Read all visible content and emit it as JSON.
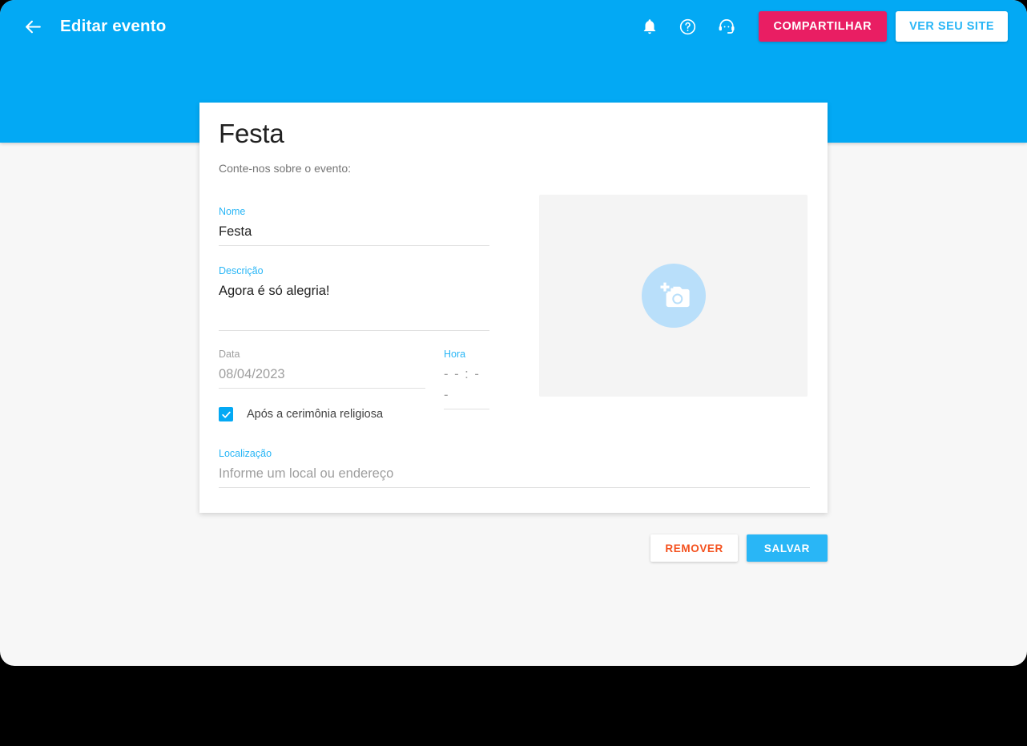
{
  "topbar": {
    "back_icon": "arrow-left-icon",
    "title": "Editar evento",
    "icons": [
      {
        "name": "notifications-bell-icon"
      },
      {
        "name": "help-circle-icon"
      },
      {
        "name": "support-headset-icon"
      }
    ],
    "share_label": "COMPARTILHAR",
    "view_site_label": "VER SEU SITE",
    "background_color": "#03a9f4",
    "share_color": "#e91e63",
    "view_site_text_color": "#29b6f6"
  },
  "card": {
    "title": "Festa",
    "subtitle": "Conte-nos sobre o evento:",
    "fields": {
      "nome": {
        "label": "Nome",
        "value": "Festa"
      },
      "descricao": {
        "label": "Descrição",
        "value": "Agora é só alegria!"
      },
      "data": {
        "label": "Data",
        "value": "08/04/2023"
      },
      "hora": {
        "label": "Hora",
        "value": "- - : - -"
      },
      "localizacao": {
        "label": "Localização",
        "placeholder": "Informe um local ou endereço"
      }
    },
    "checkbox": {
      "label": "Após a cerimônia religiosa",
      "checked": true,
      "color": "#03a9f4"
    },
    "image_upload": {
      "icon": "add-a-photo-icon",
      "circle_color": "#b9dffa",
      "background_color": "#f4f4f4"
    }
  },
  "actions": {
    "remove_label": "REMOVER",
    "remove_color": "#f4511e",
    "save_label": "SALVAR",
    "save_color": "#29b6f6"
  }
}
